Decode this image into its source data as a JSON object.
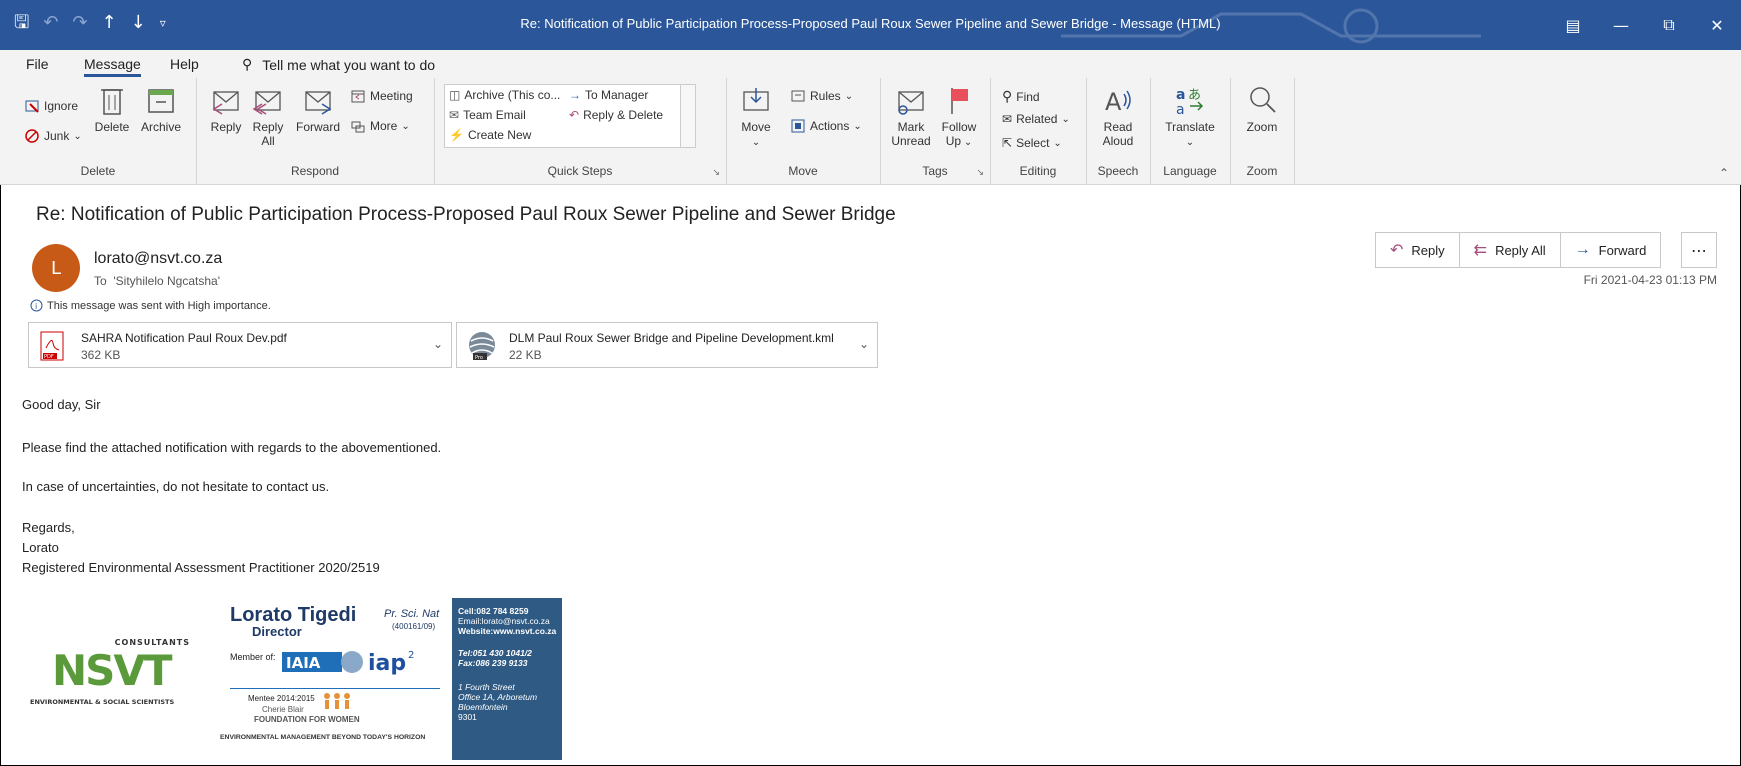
{
  "window": {
    "title": "Re: Notification of Public Participation Process-Proposed Paul Roux Sewer Pipeline and Sewer Bridge  -  Message (HTML)"
  },
  "tabs": [
    {
      "label": "File"
    },
    {
      "label": "Message",
      "active": true
    },
    {
      "label": "Help"
    }
  ],
  "tell_me": "Tell me what you want to do",
  "ribbon": {
    "delete_group": {
      "label": "Delete",
      "ignore": "Ignore",
      "junk": "Junk",
      "delete": "Delete",
      "archive": "Archive"
    },
    "respond_group": {
      "label": "Respond",
      "reply": "Reply",
      "reply_all_1": "Reply",
      "reply_all_2": "All",
      "forward": "Forward",
      "meeting": "Meeting",
      "more": "More"
    },
    "quick_steps": {
      "label": "Quick Steps",
      "archive": "Archive (This co...",
      "to_manager": "To Manager",
      "team_email": "Team Email",
      "reply_delete": "Reply & Delete",
      "create_new": "Create New"
    },
    "move_group": {
      "label": "Move",
      "move": "Move",
      "rules": "Rules",
      "actions": "Actions"
    },
    "tags_group": {
      "label": "Tags",
      "mark_unread_1": "Mark",
      "mark_unread_2": "Unread",
      "follow_up_1": "Follow",
      "follow_up_2": "Up"
    },
    "editing_group": {
      "label": "Editing",
      "find": "Find",
      "related": "Related",
      "select": "Select"
    },
    "speech_group": {
      "label": "Speech",
      "read_aloud_1": "Read",
      "read_aloud_2": "Aloud"
    },
    "language_group": {
      "label": "Language",
      "translate": "Translate"
    },
    "zoom_group": {
      "label": "Zoom",
      "zoom": "Zoom"
    }
  },
  "message": {
    "subject": "Re: Notification of Public Participation Process-Proposed Paul Roux Sewer Pipeline and Sewer Bridge",
    "avatar_initial": "L",
    "from": "lorato@nsvt.co.za",
    "to_label": "To",
    "to": "'Sityhilelo Ngcatsha'",
    "importance": "This message was sent with High importance.",
    "date": "Fri 2021-04-23 01:13 PM",
    "actions": {
      "reply": "Reply",
      "reply_all": "Reply All",
      "forward": "Forward"
    },
    "attachments": [
      {
        "name": "SAHRA Notification Paul Roux Dev.pdf",
        "size": "362 KB",
        "icon": "pdf-icon"
      },
      {
        "name": "DLM Paul Roux Sewer Bridge and Pipeline Development.kml",
        "size": "22 KB",
        "icon": "kml-icon"
      }
    ],
    "body": [
      "Good day, Sir",
      "Please find the attached notification with regards  to the abovementioned.",
      "In case of uncertainties, do not hesitate to contact us.",
      "Regards,",
      "Lorato",
      "Registered Environmental Assessment Practitioner 2020/2519"
    ]
  },
  "signature": {
    "logo_text": "NSVT",
    "consultants": "CONSULTANTS",
    "logo_tagline": "ENVIRONMENTAL & SOCIAL SCIENTISTS",
    "name": "Lorato Tigedi",
    "credential": "Pr. Sci. Nat",
    "reg_no": "(400161/09)",
    "title": "Director",
    "member_of": "Member of:",
    "mentee": "Mentee 2014:2015",
    "mentee_org_1": "Cherie Blair",
    "mentee_org_2": "FOUNDATION FOR WOMEN",
    "slogan": "ENVIRONMENTAL MANAGEMENT BEYOND TODAY'S HORIZON",
    "cell": "Cell:082 784 8259",
    "email": "Email:lorato@nsvt.co.za",
    "website": "Website:www.nsvt.co.za",
    "tel": "Tel:051 430 1041/2",
    "fax": "Fax:086 239 9133",
    "addr1": "1 Fourth Street",
    "addr2": "Office 1A, Arboretum",
    "addr3": "Bloemfontein",
    "addr4": "9301"
  }
}
